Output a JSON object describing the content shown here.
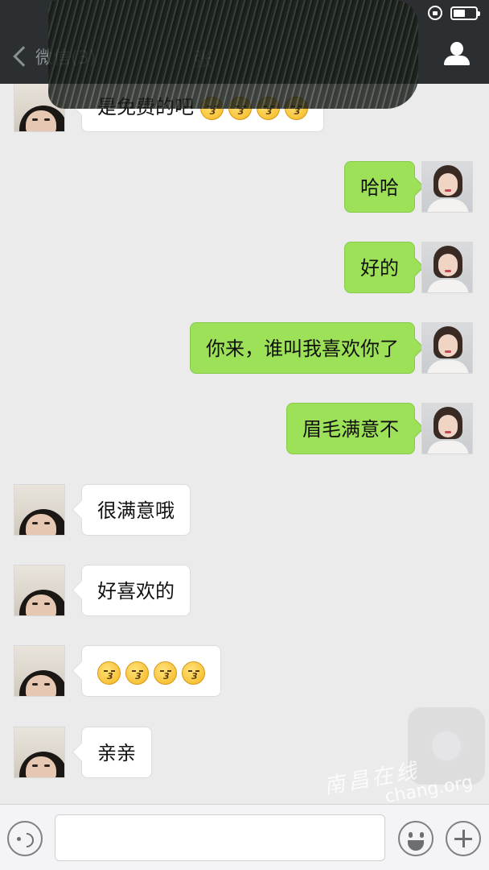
{
  "header": {
    "back_label": "微信(3)",
    "title": "张"
  },
  "status": {
    "battery_fraction": 0.55
  },
  "messages": [
    {
      "side": "in",
      "text": "是免费的吧",
      "emoji_count": 4
    },
    {
      "side": "out",
      "text": "哈哈"
    },
    {
      "side": "out",
      "text": "好的"
    },
    {
      "side": "out",
      "text": "你来，谁叫我喜欢你了"
    },
    {
      "side": "out",
      "text": "眉毛满意不"
    },
    {
      "side": "in",
      "text": "很满意哦"
    },
    {
      "side": "in",
      "text": "好喜欢的"
    },
    {
      "side": "in",
      "text": "",
      "emoji_count": 4
    },
    {
      "side": "in",
      "text": "亲亲"
    }
  ],
  "input": {
    "value": "",
    "placeholder": ""
  },
  "watermark": {
    "text": "南昌在线",
    "url": "chang.org"
  },
  "colors": {
    "header_bg": "#2b2f31",
    "chat_bg": "#ebebeb",
    "outgoing_bubble": "#9de158",
    "incoming_bubble": "#ffffff"
  },
  "icons": [
    "back-chevron-icon",
    "profile-icon",
    "rotation-lock-icon",
    "battery-icon",
    "voice-icon",
    "emoji-icon",
    "plus-icon"
  ]
}
